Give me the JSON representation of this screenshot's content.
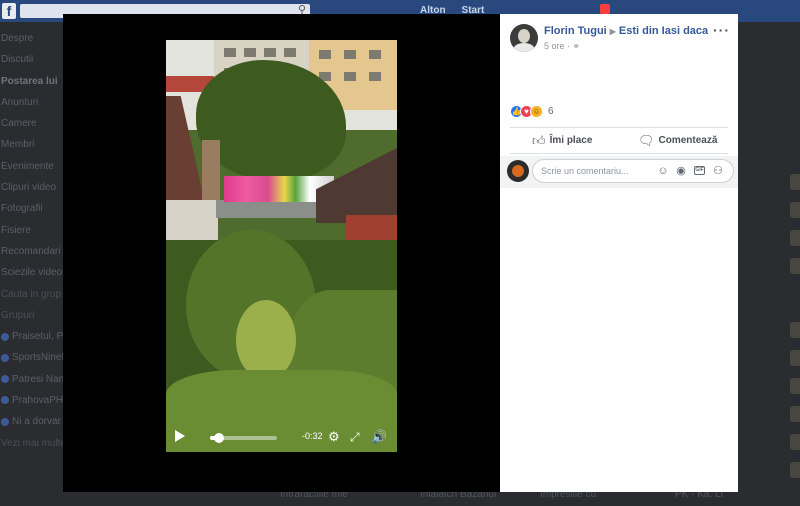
{
  "background": {
    "logo": "f",
    "search_icon": "search-icon",
    "top_links": [
      "Alton",
      "Start"
    ],
    "left_nav": [
      {
        "label": "Despre",
        "style": "normal"
      },
      {
        "label": "Discutii",
        "style": "normal"
      },
      {
        "label": "Postarea lui",
        "style": "bold"
      },
      {
        "label": "Anunturi",
        "style": "normal"
      },
      {
        "label": "Camere",
        "style": "normal"
      },
      {
        "label": "Membri",
        "style": "normal"
      },
      {
        "label": "Evenimente",
        "style": "normal"
      },
      {
        "label": "Clipuri video",
        "style": "normal"
      },
      {
        "label": "Fotografii",
        "style": "normal"
      },
      {
        "label": "Fisiere",
        "style": "normal"
      },
      {
        "label": "Recomandari",
        "style": "normal"
      },
      {
        "label": "Sciezile video",
        "style": "normal"
      },
      {
        "label": "Cauta in grup",
        "style": "section"
      },
      {
        "label": "Grupuri",
        "style": "section"
      },
      {
        "label": "Praisetul, Pi",
        "style": "dot"
      },
      {
        "label": "SportsNineF",
        "style": "dot"
      },
      {
        "label": "Patresi Nan",
        "style": "dot"
      },
      {
        "label": "PrahovaPH",
        "style": "dot"
      },
      {
        "label": "Ni a dorvar",
        "style": "dot"
      },
      {
        "label": "Vezi mai multe",
        "style": "section"
      }
    ],
    "bottom_items": [
      "Intraractiile mie",
      "Inialatch Bazanul",
      "Impresiile cu",
      "PK - Ka. Li"
    ]
  },
  "video": {
    "time_remaining": "-0:32",
    "progress": 0.14,
    "play_icon": "play-icon",
    "settings_icon": "gear-icon",
    "fullscreen_icon": "expand-icon",
    "volume_icon": "volume-icon"
  },
  "post": {
    "author": "Florin Tugui",
    "group": "Esti din Iasi daca...",
    "verified_icon": "check-icon",
    "time": "5 ore",
    "audience_icon": "globe-icon",
    "more_icon": "more-icon",
    "reaction_count": "6",
    "reaction_icons": [
      "like-icon",
      "love-icon",
      "haha-icon"
    ],
    "like_label": "Îmi place",
    "comment_label": "Comentează",
    "comment_placeholder": "Scrie un comentariu...",
    "comment_icons": [
      "emoji-icon",
      "camera-icon",
      "gif-icon",
      "sticker-icon"
    ]
  }
}
